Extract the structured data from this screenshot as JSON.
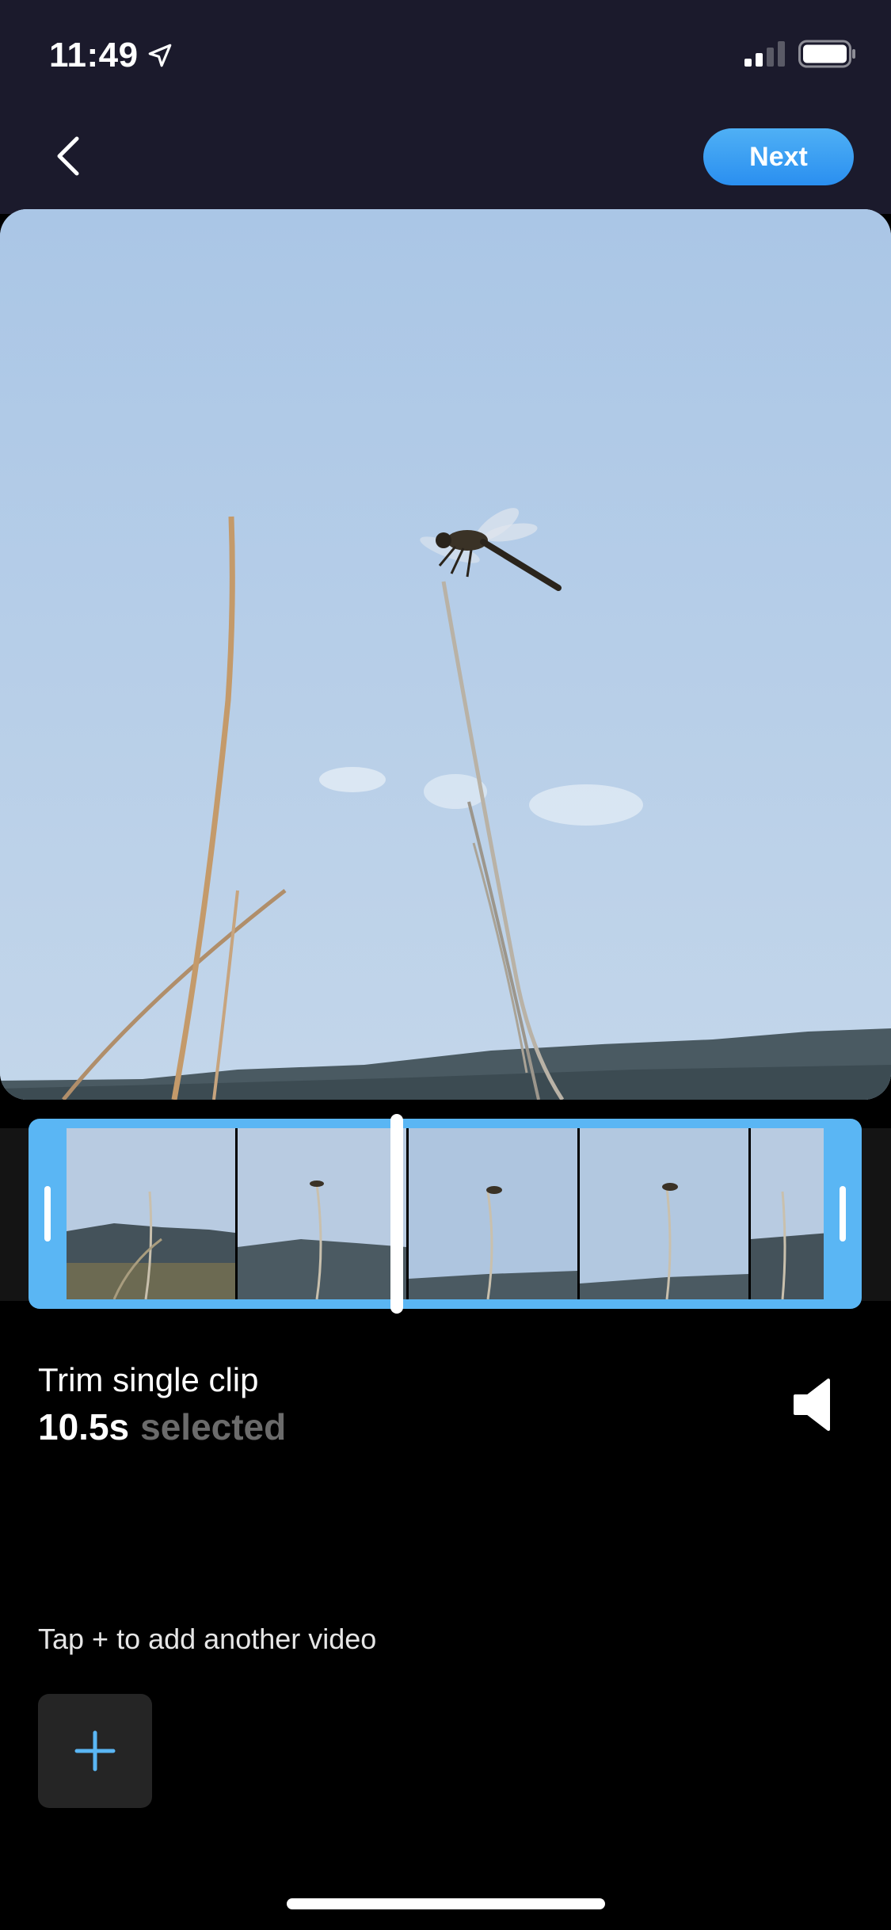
{
  "status_bar": {
    "time": "11:49",
    "location_icon": "location-arrow-icon",
    "signal_icon": "cellular-signal-icon",
    "battery_icon": "battery-icon"
  },
  "nav": {
    "back_icon": "chevron-left-icon",
    "next_label": "Next"
  },
  "colors": {
    "accent": "#4fa6f2",
    "trim_frame": "#5ab6f4",
    "top_bar_bg": "#1b1a2c",
    "background": "#000000",
    "muted_text": "#6b6b6b"
  },
  "trim": {
    "title": "Trim single clip",
    "duration": "10.5s",
    "selected_word": "selected",
    "volume_icon": "speaker-icon"
  },
  "add_video": {
    "hint": "Tap + to add another video",
    "button_icon": "plus-icon"
  }
}
